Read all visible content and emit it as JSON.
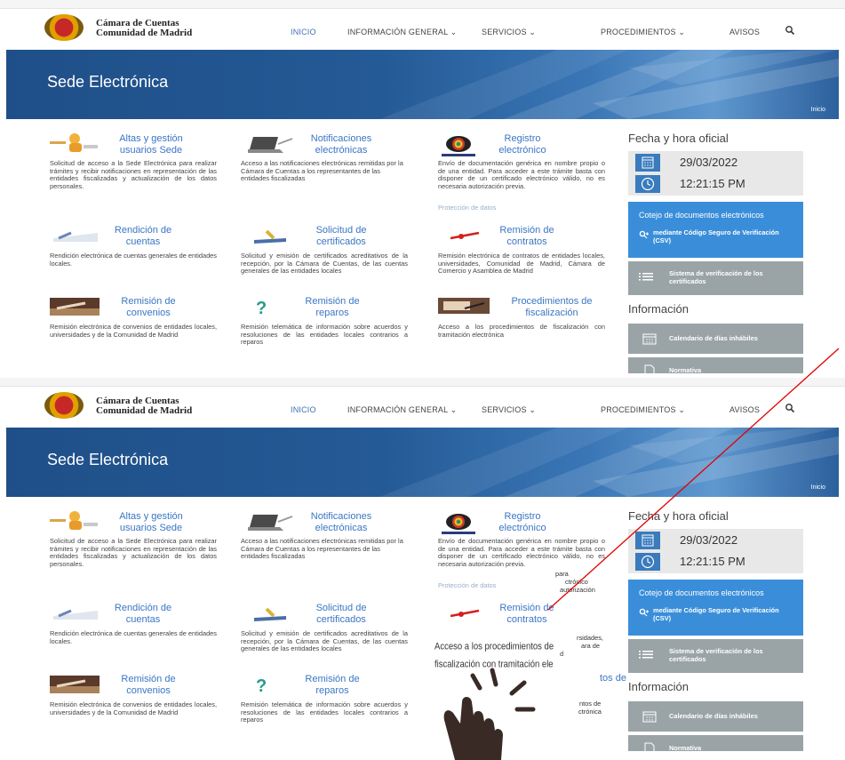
{
  "header": {
    "logo_line1": "Cámara de Cuentas",
    "logo_line2": "Comunidad de Madrid",
    "nav": [
      {
        "label": "INICIO",
        "active": true
      },
      {
        "label": "INFORMACIÓN GENERAL ⌄",
        "active": false
      },
      {
        "label": "SERVICIOS ⌄",
        "active": false
      },
      {
        "label": "PROCEDIMIENTOS ⌄",
        "active": false
      },
      {
        "label": "AVISOS",
        "active": false
      }
    ],
    "search_icon": "search-icon"
  },
  "banner": {
    "title": "Sede Electrónica",
    "breadcrumb": "Inicio"
  },
  "services": [
    {
      "title_l1": "Altas y gestión",
      "title_l2": "usuarios Sede",
      "desc": "Solicitud de acceso a la Sede Electrónica para realizar trámites y recibir notificaciones en representación de las entidades fiscalizadas y actualización de los datos personales.",
      "icon": "user-management-icon"
    },
    {
      "title_l1": "Notificaciones",
      "title_l2": "electrónicas",
      "desc": "Acceso a las notificaciones electrónicas remitidas por la Cámara de Cuentas a los representantes de las entidades fiscalizadas",
      "icon": "laptop-notification-icon"
    },
    {
      "title_l1": "Registro",
      "title_l2": "electrónico",
      "desc": "Envío de documentación genérica en nombre propio o de una entidad. Para acceder a este trámite basta con disponer de un certificado electrónico válido, no es necesaria autorización previa.",
      "link": "Protección de datos",
      "icon": "registry-disc-icon"
    },
    {
      "title_l1": "Rendición de",
      "title_l2": "cuentas",
      "desc": "Rendición electrónica de cuentas generales de entidades locales.",
      "icon": "accounts-icon"
    },
    {
      "title_l1": "Solicitud de",
      "title_l2": "certificados",
      "desc": "Solicitud y emisión de certificados acreditativos de la recepción, por la Cámara de Cuentas, de las cuentas generales de las entidades locales",
      "icon": "certificate-icon"
    },
    {
      "title_l1": "Remisión de",
      "title_l2": "contratos",
      "desc": "Remisión electrónica de contratos de entidades locales, universidades, Comunidad de Madrid, Cámara de Comercio y Asamblea de Madrid",
      "icon": "contract-icon"
    },
    {
      "title_l1": "Remisión de",
      "title_l2": "convenios",
      "desc": "Remisión electrónica de convenios de entidades locales, universidades y de la Comunidad de Madrid",
      "icon": "agreement-icon"
    },
    {
      "title_l1": "Remisión de",
      "title_l2": "reparos",
      "desc": "Remisión telemática de información sobre acuerdos y resoluciones de las entidades locales contrarios a reparos",
      "icon": "objections-icon"
    },
    {
      "title_l1": "Procedimientos de",
      "title_l2": "fiscalización",
      "desc": "Acceso a los procedimientos de fiscalización con tramitación electrónica",
      "icon": "audit-procedures-icon"
    }
  ],
  "sidebar": {
    "time_heading": "Fecha y hora oficial",
    "date": "29/03/2022",
    "time": "12:21:15 PM",
    "cotejo_title": "Cotejo de documentos electrónicos",
    "cotejo_sub": "mediante Código Seguro de Verificación (CSV)",
    "verif": "Sistema de verificación de los certificados",
    "info_heading": "Información",
    "calendar": "Calendario de días inhábiles",
    "normativa": "Normativa"
  },
  "overlay": {
    "fragments": {
      "reg_acceder_right": "para",
      "reg_disponer_right": "ctrónico",
      "reg_valido_right": "autorización",
      "contratos_l2_right": "rsidades,",
      "contratos_l3_right": "ara de",
      "contratos_l4_right": "d",
      "proc_title_right": "tos de",
      "proc_desc_l1_right": "ntos de",
      "proc_desc_l2_right": "ctrónica"
    },
    "line1": "Acceso   a   los   procedimientos  de",
    "line2": "fiscalización con tramitación ele",
    "colors": {
      "arrow_line": "#e00000",
      "cursor": "#3a2a26"
    }
  }
}
